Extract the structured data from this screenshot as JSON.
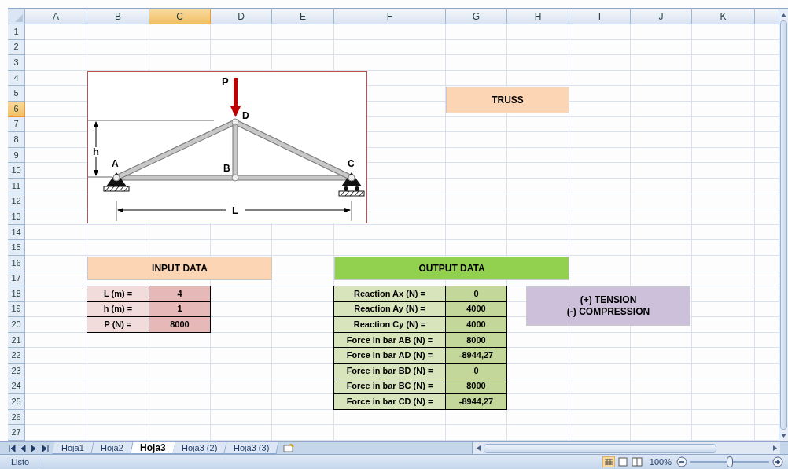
{
  "columns": [
    {
      "label": "A",
      "selected": false
    },
    {
      "label": "B",
      "selected": false
    },
    {
      "label": "C",
      "selected": true
    },
    {
      "label": "D",
      "selected": false
    },
    {
      "label": "E",
      "selected": false
    },
    {
      "label": "F",
      "selected": false
    },
    {
      "label": "G",
      "selected": false
    },
    {
      "label": "H",
      "selected": false
    },
    {
      "label": "I",
      "selected": false
    },
    {
      "label": "J",
      "selected": false
    },
    {
      "label": "K",
      "selected": false
    }
  ],
  "rows": [
    {
      "label": "1",
      "selected": false
    },
    {
      "label": "2",
      "selected": false
    },
    {
      "label": "3",
      "selected": false
    },
    {
      "label": "4",
      "selected": false
    },
    {
      "label": "5",
      "selected": false
    },
    {
      "label": "6",
      "selected": true
    },
    {
      "label": "7",
      "selected": false
    },
    {
      "label": "8",
      "selected": false
    },
    {
      "label": "9",
      "selected": false
    },
    {
      "label": "10",
      "selected": false
    },
    {
      "label": "11",
      "selected": false
    },
    {
      "label": "12",
      "selected": false
    },
    {
      "label": "13",
      "selected": false
    },
    {
      "label": "14",
      "selected": false
    },
    {
      "label": "15",
      "selected": false
    },
    {
      "label": "16",
      "selected": false
    },
    {
      "label": "17",
      "selected": false
    },
    {
      "label": "18",
      "selected": false
    },
    {
      "label": "19",
      "selected": false
    },
    {
      "label": "20",
      "selected": false
    },
    {
      "label": "21",
      "selected": false
    },
    {
      "label": "22",
      "selected": false
    },
    {
      "label": "23",
      "selected": false
    },
    {
      "label": "24",
      "selected": false
    },
    {
      "label": "25",
      "selected": false
    },
    {
      "label": "26",
      "selected": false
    },
    {
      "label": "27",
      "selected": false
    }
  ],
  "truss_figure": {
    "load": "P",
    "node_a": "A",
    "node_b": "B",
    "node_c": "C",
    "node_d": "D",
    "height": "h",
    "length": "L"
  },
  "truss_title": "TRUSS",
  "input_data": {
    "title": "INPUT DATA",
    "rows": [
      {
        "label": "L (m) =",
        "value": "4"
      },
      {
        "label": "h (m) =",
        "value": "1"
      },
      {
        "label": "P (N) =",
        "value": "8000"
      }
    ]
  },
  "output_data": {
    "title": "OUTPUT DATA",
    "rows": [
      {
        "label": "Reaction Ax (N) =",
        "value": "0"
      },
      {
        "label": "Reaction Ay (N) =",
        "value": "4000"
      },
      {
        "label": "Reaction Cy (N) =",
        "value": "4000"
      },
      {
        "label": "Force in bar AB (N) =",
        "value": "8000"
      },
      {
        "label": "Force in bar AD (N) =",
        "value": "-8944,27"
      },
      {
        "label": "Force in bar BD (N) =",
        "value": "0"
      },
      {
        "label": "Force in bar BC (N) =",
        "value": "8000"
      },
      {
        "label": "Force in bar CD (N) =",
        "value": "-8944,27"
      }
    ]
  },
  "legend": [
    "(+) TENSION",
    "(-) COMPRESSION"
  ],
  "sheet_tabs": [
    {
      "label": "Hoja1",
      "selected": false
    },
    {
      "label": "Hoja2",
      "selected": false
    },
    {
      "label": "Hoja3",
      "selected": true
    },
    {
      "label": "Hoja3 (2)",
      "selected": false
    },
    {
      "label": "Hoja3 (3)",
      "selected": false
    }
  ],
  "status_bar": {
    "status": "Listo",
    "zoom": "100%",
    "zoom_slider": {
      "level": 0.5
    }
  }
}
